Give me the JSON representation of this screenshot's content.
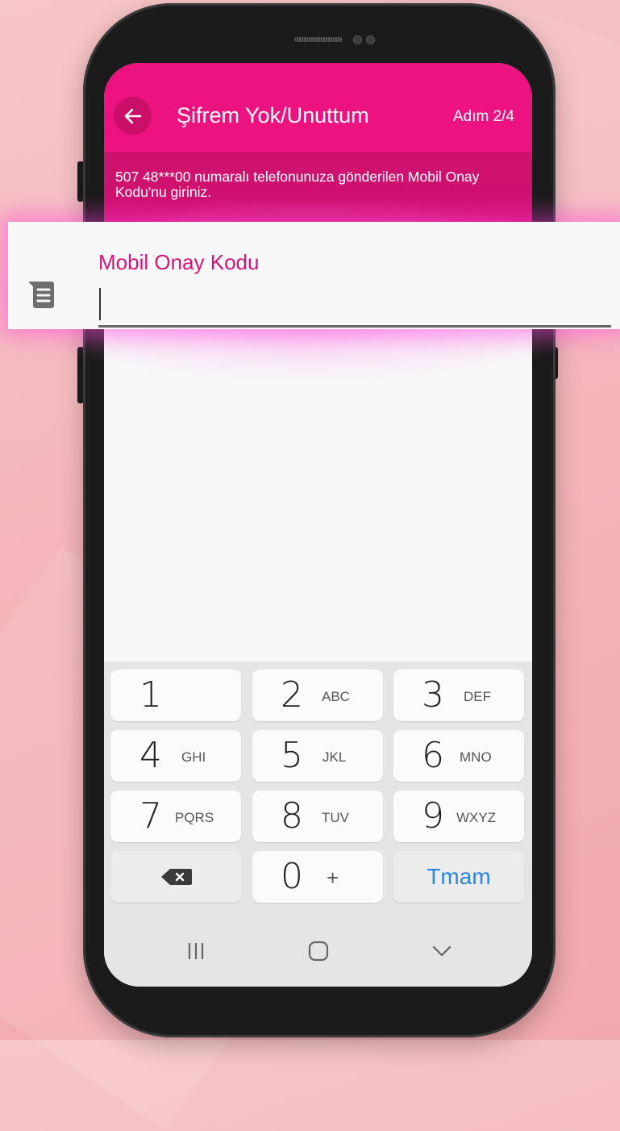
{
  "header": {
    "title": "Şifrem Yok/Unuttum",
    "step": "Adım 2/4",
    "back_icon": "arrow-left-icon",
    "color": "#ec1380"
  },
  "info": {
    "text": "507 48***00 numaralı telefonunuza gönderilen Mobil Onay Kodu'nu giriniz.",
    "color": "#cf1170"
  },
  "code_field": {
    "label": "Mobil Onay Kodu",
    "value": "",
    "icon": "sms-message-icon",
    "label_color": "#d4147b"
  },
  "keyboard": {
    "keys": [
      {
        "digit": "1",
        "letters": ""
      },
      {
        "digit": "2",
        "letters": "ABC"
      },
      {
        "digit": "3",
        "letters": "DEF"
      },
      {
        "digit": "4",
        "letters": "GHI"
      },
      {
        "digit": "5",
        "letters": "JKL"
      },
      {
        "digit": "6",
        "letters": "MNO"
      },
      {
        "digit": "7",
        "letters": "PQRS"
      },
      {
        "digit": "8",
        "letters": "TUV"
      },
      {
        "digit": "9",
        "letters": "WXYZ"
      },
      {
        "digit": "",
        "letters": ""
      },
      {
        "digit": "0",
        "letters": "+"
      },
      {
        "digit": "",
        "letters": ""
      }
    ],
    "backspace_icon": "backspace-icon",
    "done_label": "Tmam",
    "done_color": "#2a86e0"
  },
  "nav_bar": {
    "recents_icon": "recents-icon",
    "home_icon": "home-icon",
    "back_icon": "hide-keyboard-chevron-icon"
  }
}
